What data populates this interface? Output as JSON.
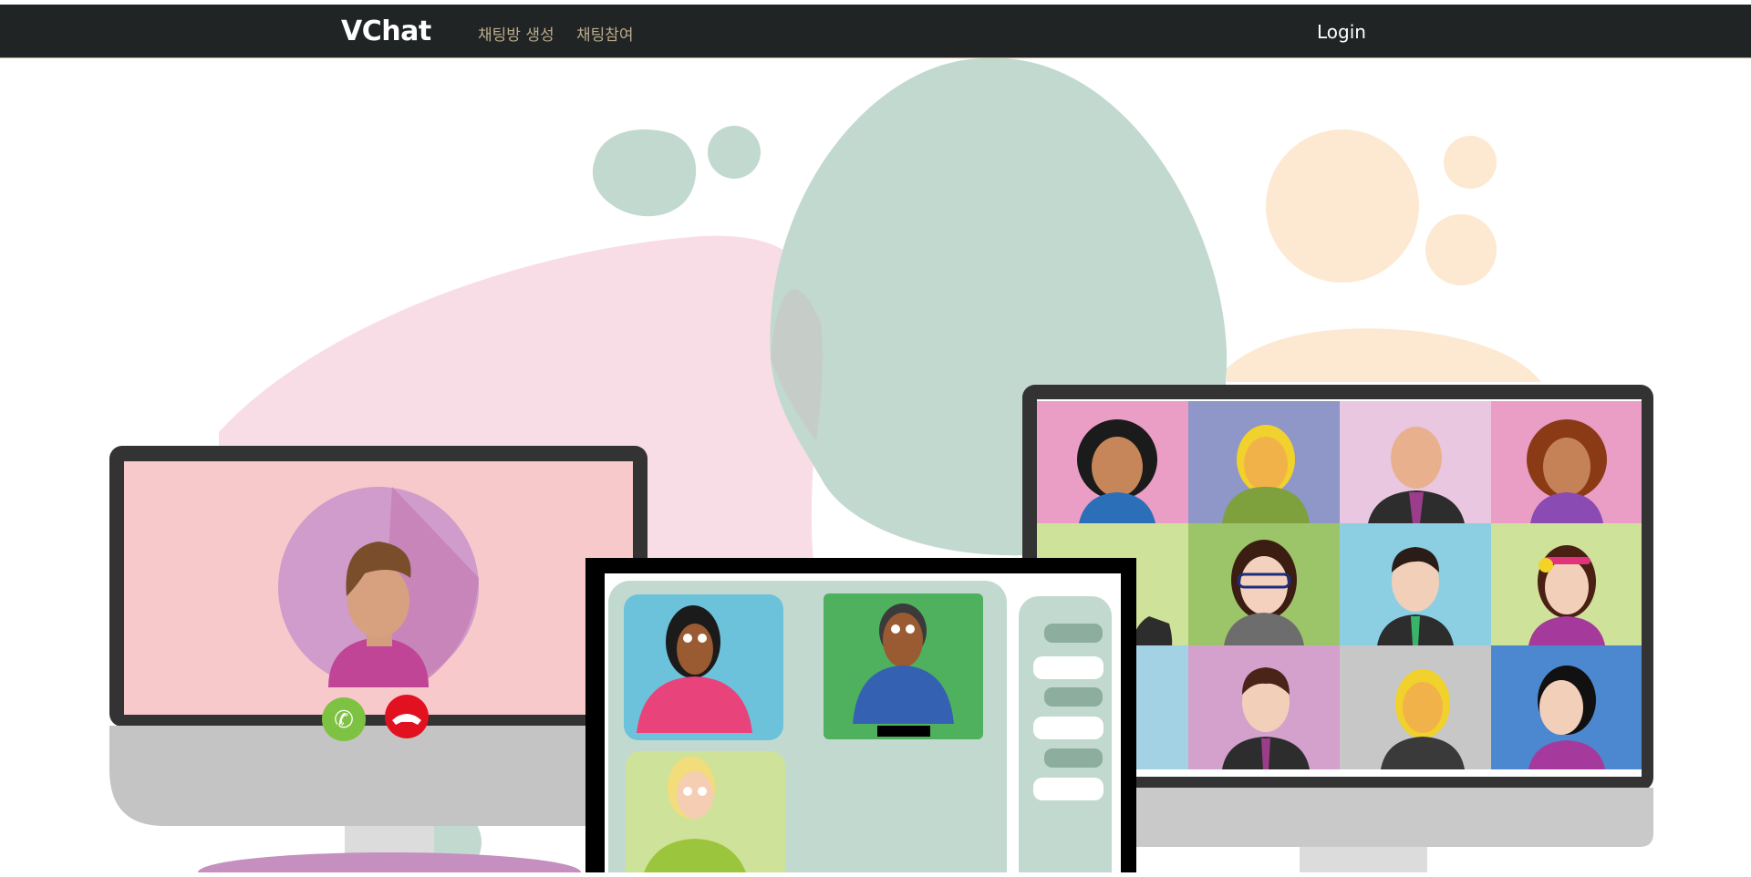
{
  "navbar": {
    "brand": "VChat",
    "links": [
      "채팅방 생성",
      "채팅참여"
    ],
    "login": "Login",
    "background": "#202424",
    "link_color": "#b9ab8c"
  },
  "hero": {
    "illustration": "video-conference-illustration",
    "colors": {
      "pink_blob": "#f9dde6",
      "green_blob": "#c2d9d0",
      "peach_blob": "#fde8d2",
      "monitor_frame": "#333333",
      "call_accept": "#7dc243",
      "call_decline": "#e1111f"
    }
  }
}
